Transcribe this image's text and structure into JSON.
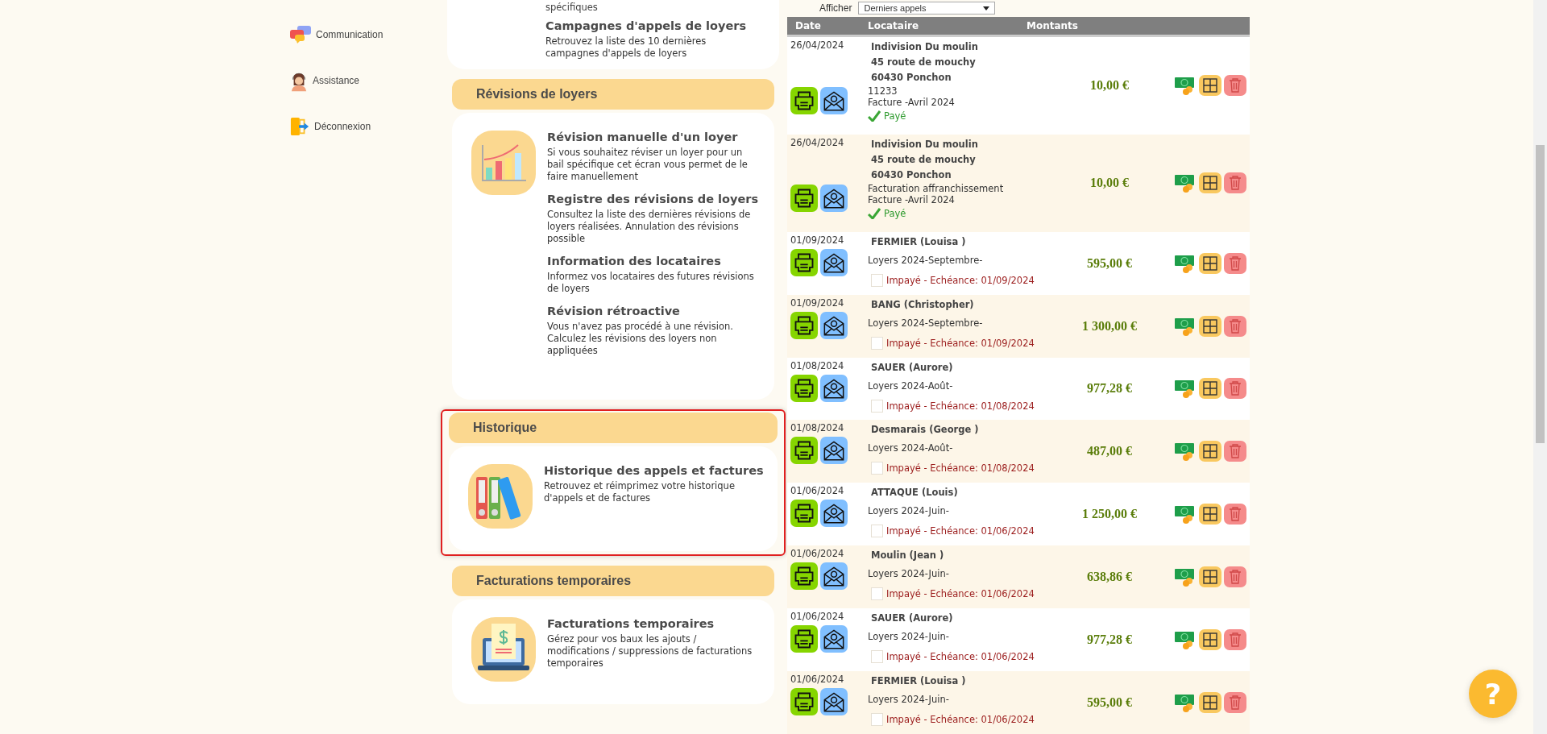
{
  "sidebar": {
    "items": [
      {
        "label": "Communication",
        "kind": "chat"
      },
      {
        "label": "Assistance",
        "kind": "support"
      },
      {
        "label": "Déconnexion",
        "kind": "logout"
      }
    ]
  },
  "menu": {
    "top_card": {
      "tail": "spécifiques",
      "entries": [
        {
          "title": "Campagnes d'appels de loyers",
          "text": "Retrouvez la liste des 10 dernières campagnes d'appels de loyers"
        }
      ]
    },
    "sections": [
      {
        "title": "Révisions de loyers",
        "highlighted": false,
        "kind": "chart",
        "entries": [
          {
            "title": "Révision manuelle d'un loyer",
            "text": "Si vous souhaitez réviser un loyer pour un bail spécifique cet écran vous permet de le faire manuellement"
          },
          {
            "title": "Registre des révisions de loyers",
            "text": "Consultez la liste des dernières révisions de loyers réalisées. Annulation des révisions possible"
          },
          {
            "title": "Information des locataires",
            "text": "Informez vos locataires des futures révisions de loyers"
          },
          {
            "title": "Révision rétroactive",
            "text": "Vous n'avez pas procédé à une révision. Calculez les révisions des loyers non appliquées"
          }
        ]
      },
      {
        "title": "Historique",
        "highlighted": true,
        "kind": "binders",
        "entries": [
          {
            "title": "Historique des appels et factures",
            "text": "Retrouvez et réimprimez votre historique d'appels et de factures"
          }
        ]
      },
      {
        "title": "Facturations temporaires",
        "highlighted": false,
        "kind": "invoice",
        "entries": [
          {
            "title": "Facturations temporaires",
            "text": "Gérez pour vos baux les ajouts / modifications / suppressions de facturations temporaires"
          }
        ]
      }
    ]
  },
  "table": {
    "filter": {
      "label": "Afficher",
      "value": "Derniers appels"
    },
    "columns": [
      "Date",
      "Locataire",
      "Montants"
    ],
    "rows": [
      {
        "date": "26/04/2024",
        "kind": "paid",
        "tenant_lines": [
          "Indivision Du moulin",
          "45 route de mouchy",
          "60430 Ponchon"
        ],
        "details": [
          "11233",
          "Facture -Avril 2024"
        ],
        "status": "Payé",
        "amount": "10,00 €"
      },
      {
        "date": "26/04/2024",
        "kind": "paid",
        "tenant_lines": [
          "Indivision Du moulin",
          "45 route de mouchy",
          "60430 Ponchon"
        ],
        "details": [
          "Facturation affranchissement",
          "Facture -Avril 2024"
        ],
        "status": "Payé",
        "amount": "10,00 €"
      },
      {
        "date": "01/09/2024",
        "kind": "unpaid",
        "tenant_lines": [
          "FERMIER (Louisa )"
        ],
        "details": [
          "Loyers 2024-Septembre-"
        ],
        "status": "Impayé - Echéance: 01/09/2024",
        "checked": false,
        "amount": "595,00 €"
      },
      {
        "date": "01/09/2024",
        "kind": "unpaid",
        "tenant_lines": [
          "BANG (Christopher)"
        ],
        "details": [
          "Loyers 2024-Septembre-"
        ],
        "status": "Impayé - Echéance: 01/09/2024",
        "checked": false,
        "amount": "1 300,00 €"
      },
      {
        "date": "01/08/2024",
        "kind": "unpaid",
        "tenant_lines": [
          "SAUER (Aurore)"
        ],
        "details": [
          "Loyers 2024-Août-"
        ],
        "status": "Impayé - Echéance: 01/08/2024",
        "checked": false,
        "amount": "977,28 €"
      },
      {
        "date": "01/08/2024",
        "kind": "unpaid",
        "tenant_lines": [
          "Desmarais (George )"
        ],
        "details": [
          "Loyers 2024-Août-"
        ],
        "status": "Impayé - Echéance: 01/08/2024",
        "checked": false,
        "amount": "487,00 €"
      },
      {
        "date": "01/06/2024",
        "kind": "unpaid",
        "tenant_lines": [
          "ATTAQUE (Louis)"
        ],
        "details": [
          "Loyers 2024-Juin-"
        ],
        "status": "Impayé - Echéance: 01/06/2024",
        "checked": false,
        "amount": "1 250,00 €"
      },
      {
        "date": "01/06/2024",
        "kind": "unpaid",
        "tenant_lines": [
          "Moulin (Jean )"
        ],
        "details": [
          "Loyers 2024-Juin-"
        ],
        "status": "Impayé - Echéance: 01/06/2024",
        "checked": false,
        "amount": "638,86 €"
      },
      {
        "date": "01/06/2024",
        "kind": "unpaid",
        "tenant_lines": [
          "SAUER (Aurore)"
        ],
        "details": [
          "Loyers 2024-Juin-"
        ],
        "status": "Impayé - Echéance: 01/06/2024",
        "checked": false,
        "amount": "977,28 €"
      },
      {
        "date": "01/06/2024",
        "kind": "unpaid",
        "tenant_lines": [
          "FERMIER (Louisa )"
        ],
        "details": [
          "Loyers 2024-Juin-"
        ],
        "status": "Impayé - Echéance: 01/06/2024",
        "checked": false,
        "amount": "595,00 €"
      }
    ]
  },
  "help": {
    "label": "?"
  }
}
